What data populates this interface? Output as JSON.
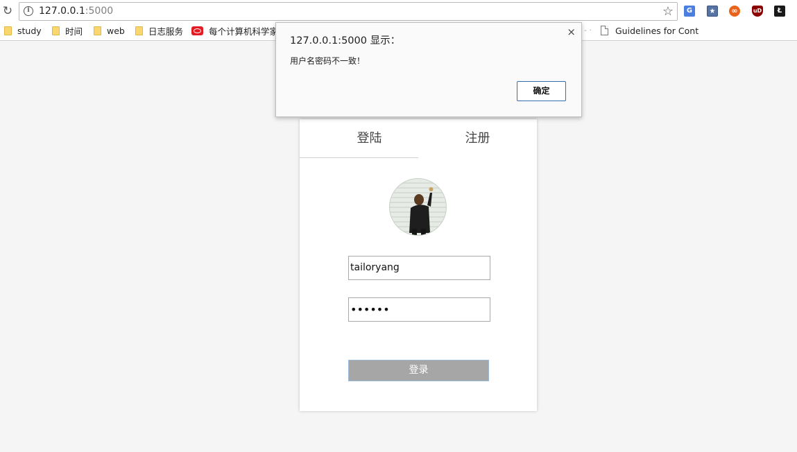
{
  "browser": {
    "url_host": "127.0.0.1",
    "url_port": ":5000",
    "bookmarks": [
      {
        "label": "study",
        "icon": "folder-icon"
      },
      {
        "label": "时间",
        "icon": "folder-icon"
      },
      {
        "label": "web",
        "icon": "folder-icon"
      },
      {
        "label": "日志服务",
        "icon": "folder-icon"
      },
      {
        "label": "每个计算机科学家",
        "icon": "oracle-icon"
      },
      {
        "label": "Guidelines for Cont",
        "icon": "document-icon"
      }
    ],
    "extensions": [
      {
        "name": "google-translate-icon",
        "glyph": "G"
      },
      {
        "name": "bookmark-star-icon",
        "glyph": "★"
      },
      {
        "name": "infinity-icon",
        "glyph": "∞"
      },
      {
        "name": "ublock-icon",
        "glyph": "uD"
      },
      {
        "name": "dark-extension-icon",
        "glyph": "Ł"
      }
    ]
  },
  "dialog": {
    "title": "127.0.0.1:5000 显示：",
    "message": "用户名密码不一致！",
    "ok_label": "确定",
    "close_glyph": "×"
  },
  "login": {
    "tab_login": "登陆",
    "tab_register": "注册",
    "username_value": "tailoryang",
    "password_mask": "••••••",
    "submit_label": "登录"
  },
  "colors": {
    "submit_bg": "#a6a6a6",
    "page_bg": "#f5f5f5",
    "dialog_ok_border": "#2f6fb2"
  }
}
